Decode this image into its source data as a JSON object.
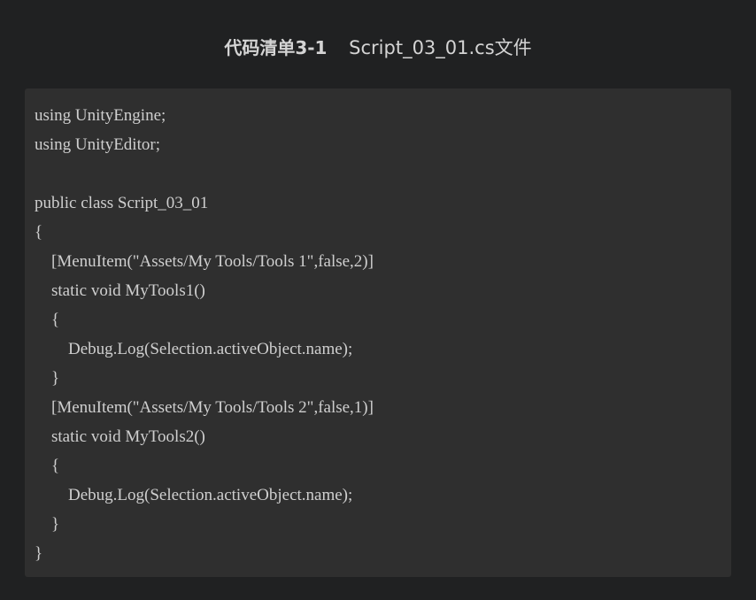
{
  "caption": {
    "label": "代码清单3-1",
    "title": "Script_03_01.cs文件"
  },
  "code": {
    "lines": [
      "using UnityEngine;",
      "using UnityEditor;",
      "",
      "public class Script_03_01",
      "{",
      "    [MenuItem(\"Assets/My Tools/Tools 1\",false,2)]",
      "    static void MyTools1()",
      "    {",
      "        Debug.Log(Selection.activeObject.name);",
      "    }",
      "    [MenuItem(\"Assets/My Tools/Tools 2\",false,1)]",
      "    static void MyTools2()",
      "    {",
      "        Debug.Log(Selection.activeObject.name);",
      "    }",
      "}"
    ]
  }
}
